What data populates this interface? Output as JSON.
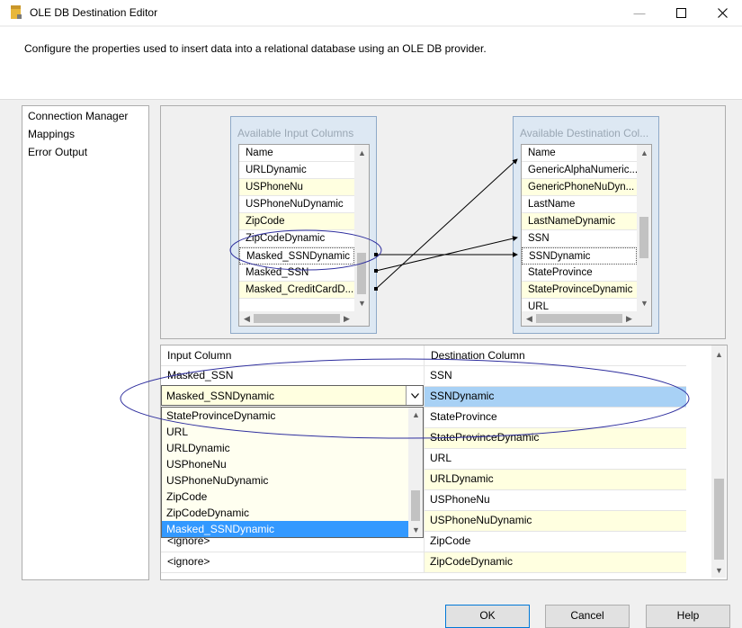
{
  "window": {
    "title": "OLE DB Destination Editor",
    "description": "Configure the properties used to insert data into a relational database using an OLE DB provider."
  },
  "nav": {
    "items": [
      "Connection Manager",
      "Mappings",
      "Error Output"
    ]
  },
  "input_columns": {
    "title": "Available Input Columns",
    "header": "Name",
    "rows": [
      "URLDynamic",
      "USPhoneNu",
      "USPhoneNuDynamic",
      "ZipCode",
      "ZipCodeDynamic",
      "Masked_SSNDynamic",
      "Masked_SSN",
      "Masked_CreditCardD..."
    ]
  },
  "destination_columns": {
    "title": "Available Destination Col...",
    "header": "Name",
    "rows": [
      "GenericAlphaNumeric...",
      "GenericPhoneNuDyn...",
      "LastName",
      "LastNameDynamic",
      "SSN",
      "SSNDynamic",
      "StateProvince",
      "StateProvinceDynamic",
      "URL"
    ]
  },
  "grid": {
    "headers": {
      "input": "Input Column",
      "destination": "Destination Column"
    },
    "rows": [
      {
        "input": "Masked_SSN",
        "destination": "SSN"
      },
      {
        "input": "Masked_SSNDynamic",
        "destination": "SSNDynamic"
      },
      {
        "input": "",
        "destination": "StateProvince"
      },
      {
        "input": "",
        "destination": "StateProvinceDynamic"
      },
      {
        "input": "",
        "destination": "URL"
      },
      {
        "input": "",
        "destination": "URLDynamic"
      },
      {
        "input": "",
        "destination": "USPhoneNu"
      },
      {
        "input": "",
        "destination": "USPhoneNuDynamic"
      },
      {
        "input": "<ignore>",
        "destination": "ZipCode"
      },
      {
        "input": "<ignore>",
        "destination": "ZipCodeDynamic"
      }
    ]
  },
  "combo": {
    "value": "Masked_SSNDynamic",
    "options": [
      "StateProvinceDynamic",
      "URL",
      "URLDynamic",
      "USPhoneNu",
      "USPhoneNuDynamic",
      "ZipCode",
      "ZipCodeDynamic",
      "Masked_SSNDynamic"
    ],
    "selected_index": 7
  },
  "buttons": {
    "ok": "OK",
    "cancel": "Cancel",
    "help": "Help"
  },
  "colors": {
    "highlight": "#3399ff",
    "row_selected": "#a8d1f5",
    "alt_row": "#ffffe0",
    "annotation": "#2e2e9e"
  }
}
